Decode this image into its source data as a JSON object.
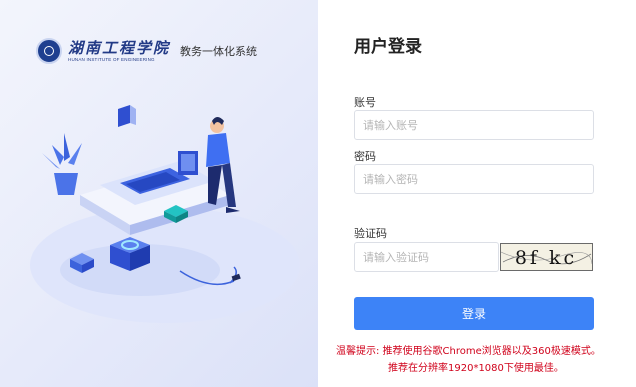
{
  "brand": {
    "school_name_cn": "湖南工程学院",
    "school_name_en": "HUNAN INSTITUTE OF ENGINEERING",
    "system_name": "教务一体化系统"
  },
  "login": {
    "title": "用户登录",
    "account_label": "账号",
    "account_placeholder": "请输入账号",
    "password_label": "密码",
    "password_placeholder": "请输入密码",
    "captcha_label": "验证码",
    "captcha_placeholder": "请输入验证码",
    "captcha_text": "8f kc",
    "submit_label": "登录"
  },
  "tips": {
    "line1": "温馨提示:  推荐使用谷歌Chrome浏览器以及360极速模式。",
    "line2": "推荐在分辨率1920*1080下使用最佳。"
  },
  "colors": {
    "accent": "#3d83f7",
    "tip_text": "#d0021b",
    "brand_blue": "#223a86"
  }
}
